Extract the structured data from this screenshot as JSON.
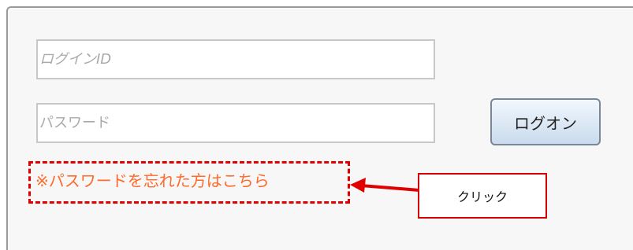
{
  "login_form": {
    "login_id": {
      "value": "",
      "placeholder": "ログインID"
    },
    "password": {
      "value": "",
      "placeholder": "パスワード"
    },
    "logon_label": "ログオン",
    "forgot_password_label": "※パスワードを忘れた方はこちら"
  },
  "annotation": {
    "callout_label": "クリック",
    "highlight_color": "#e00000",
    "arrow_color": "#e00000"
  },
  "colors": {
    "link": "#ff6a2a",
    "button_gradient_top": "#f2f7fc",
    "button_gradient_bottom": "#c9dbee"
  }
}
